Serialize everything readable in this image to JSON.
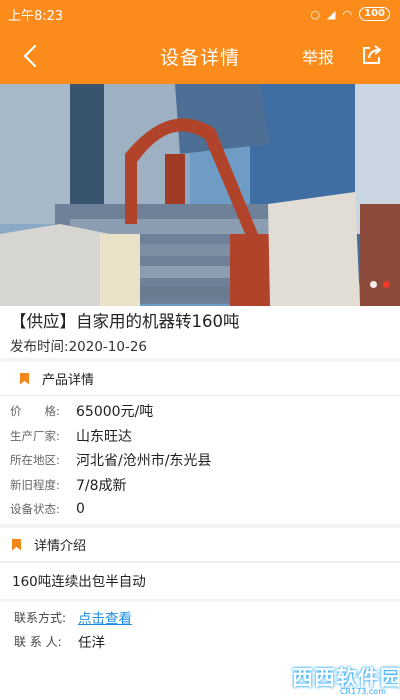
{
  "status_bar": {
    "time": "上午8:23",
    "battery": "100"
  },
  "nav": {
    "back_label": "<",
    "title": "设备详情",
    "report_label": "举报"
  },
  "product": {
    "title": "【供应】自家用的机器转160吨",
    "date_label": "发布时间:",
    "date_value": "2020-10-26"
  },
  "details_section": {
    "header": "产品详情",
    "rows": [
      {
        "label": "价　　格:",
        "value": "65000元/吨"
      },
      {
        "label": "生产厂家:",
        "value": "山东旺达"
      },
      {
        "label": "所在地区:",
        "value": "河北省/沧州市/东光县"
      },
      {
        "label": "新旧程度:",
        "value": "7/8成新"
      },
      {
        "label": "设备状态:",
        "value": "0"
      }
    ]
  },
  "intro_section": {
    "header": "详情介绍",
    "text": "160吨连续出包半自动"
  },
  "contact": {
    "method_label": "联系方式:",
    "method_link": "点击查看",
    "person_label": "联 系 人:",
    "person_value": "任洋"
  },
  "watermark": {
    "text": "西西软件园",
    "url": "CR173.com"
  },
  "colors": {
    "accent": "#fb8c1c",
    "link": "#1f8ce6",
    "bookmark": "#f2881a"
  },
  "carousel": {
    "slide_count": 2,
    "active_index": 1
  }
}
